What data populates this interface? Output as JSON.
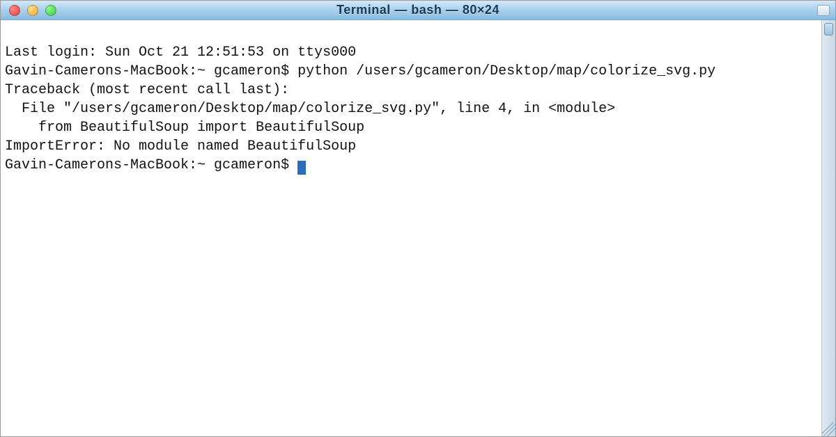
{
  "window": {
    "title": "Terminal — bash — 80×24"
  },
  "terminal": {
    "lines": [
      "Last login: Sun Oct 21 12:51:53 on ttys000",
      "Gavin-Camerons-MacBook:~ gcameron$ python /users/gcameron/Desktop/map/colorize_svg.py",
      "Traceback (most recent call last):",
      "  File \"/users/gcameron/Desktop/map/colorize_svg.py\", line 4, in <module>",
      "    from BeautifulSoup import BeautifulSoup",
      "ImportError: No module named BeautifulSoup",
      "Gavin-Camerons-MacBook:~ gcameron$ "
    ],
    "prompt": "Gavin-Camerons-MacBook:~ gcameron$"
  }
}
